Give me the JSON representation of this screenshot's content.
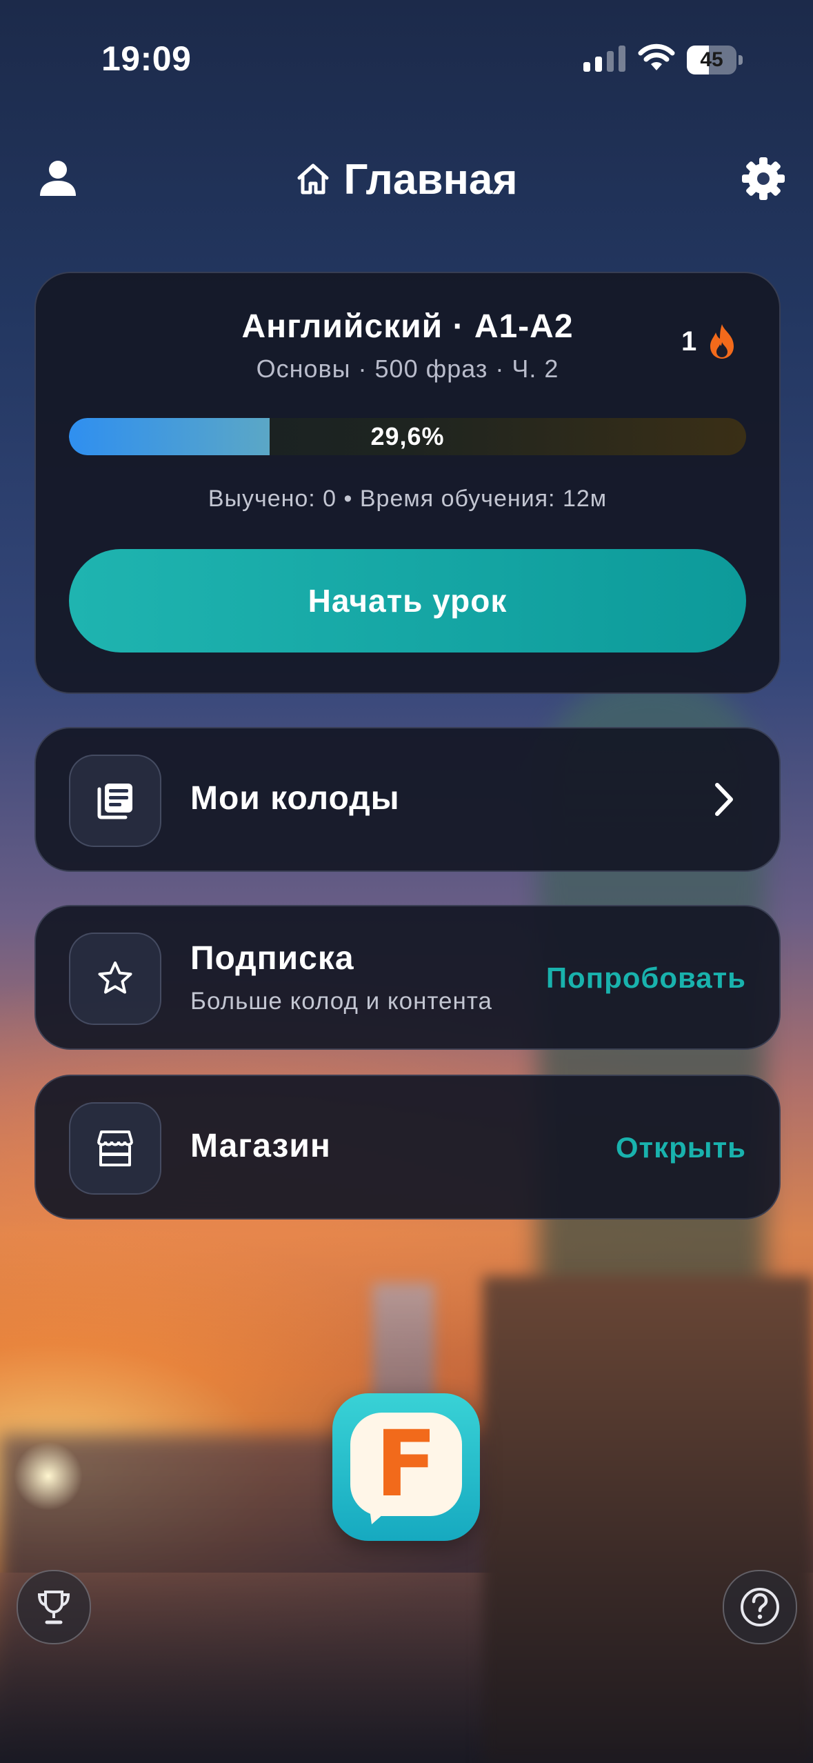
{
  "status_bar": {
    "time": "19:09",
    "battery_level": "45"
  },
  "header": {
    "title": "Главная",
    "profile_icon": "person-icon",
    "home_icon": "home-icon",
    "settings_icon": "gear-icon"
  },
  "course": {
    "title": "Английский · A1-A2",
    "subtitle": "Основы · 500 фраз · Ч. 2",
    "streak": "1",
    "streak_icon": "flame-icon",
    "progress_label": "29,6%",
    "progress_value": 0.296,
    "stats": "Выучено: 0 • Время обучения: 12м",
    "start_button": "Начать урок"
  },
  "menu": {
    "decks": {
      "label": "Мои колоды",
      "icon": "cards-icon"
    },
    "subscription": {
      "label": "Подписка",
      "sublabel": "Больше колод и контента",
      "action": "Попробовать",
      "icon": "star-icon"
    },
    "shop": {
      "label": "Магазин",
      "action": "Открыть",
      "icon": "store-icon"
    }
  },
  "logo": {
    "letter": "F"
  },
  "colors": {
    "accent": "#19b2ad",
    "flame": "#f26a1b",
    "card_bg": "#141826"
  }
}
